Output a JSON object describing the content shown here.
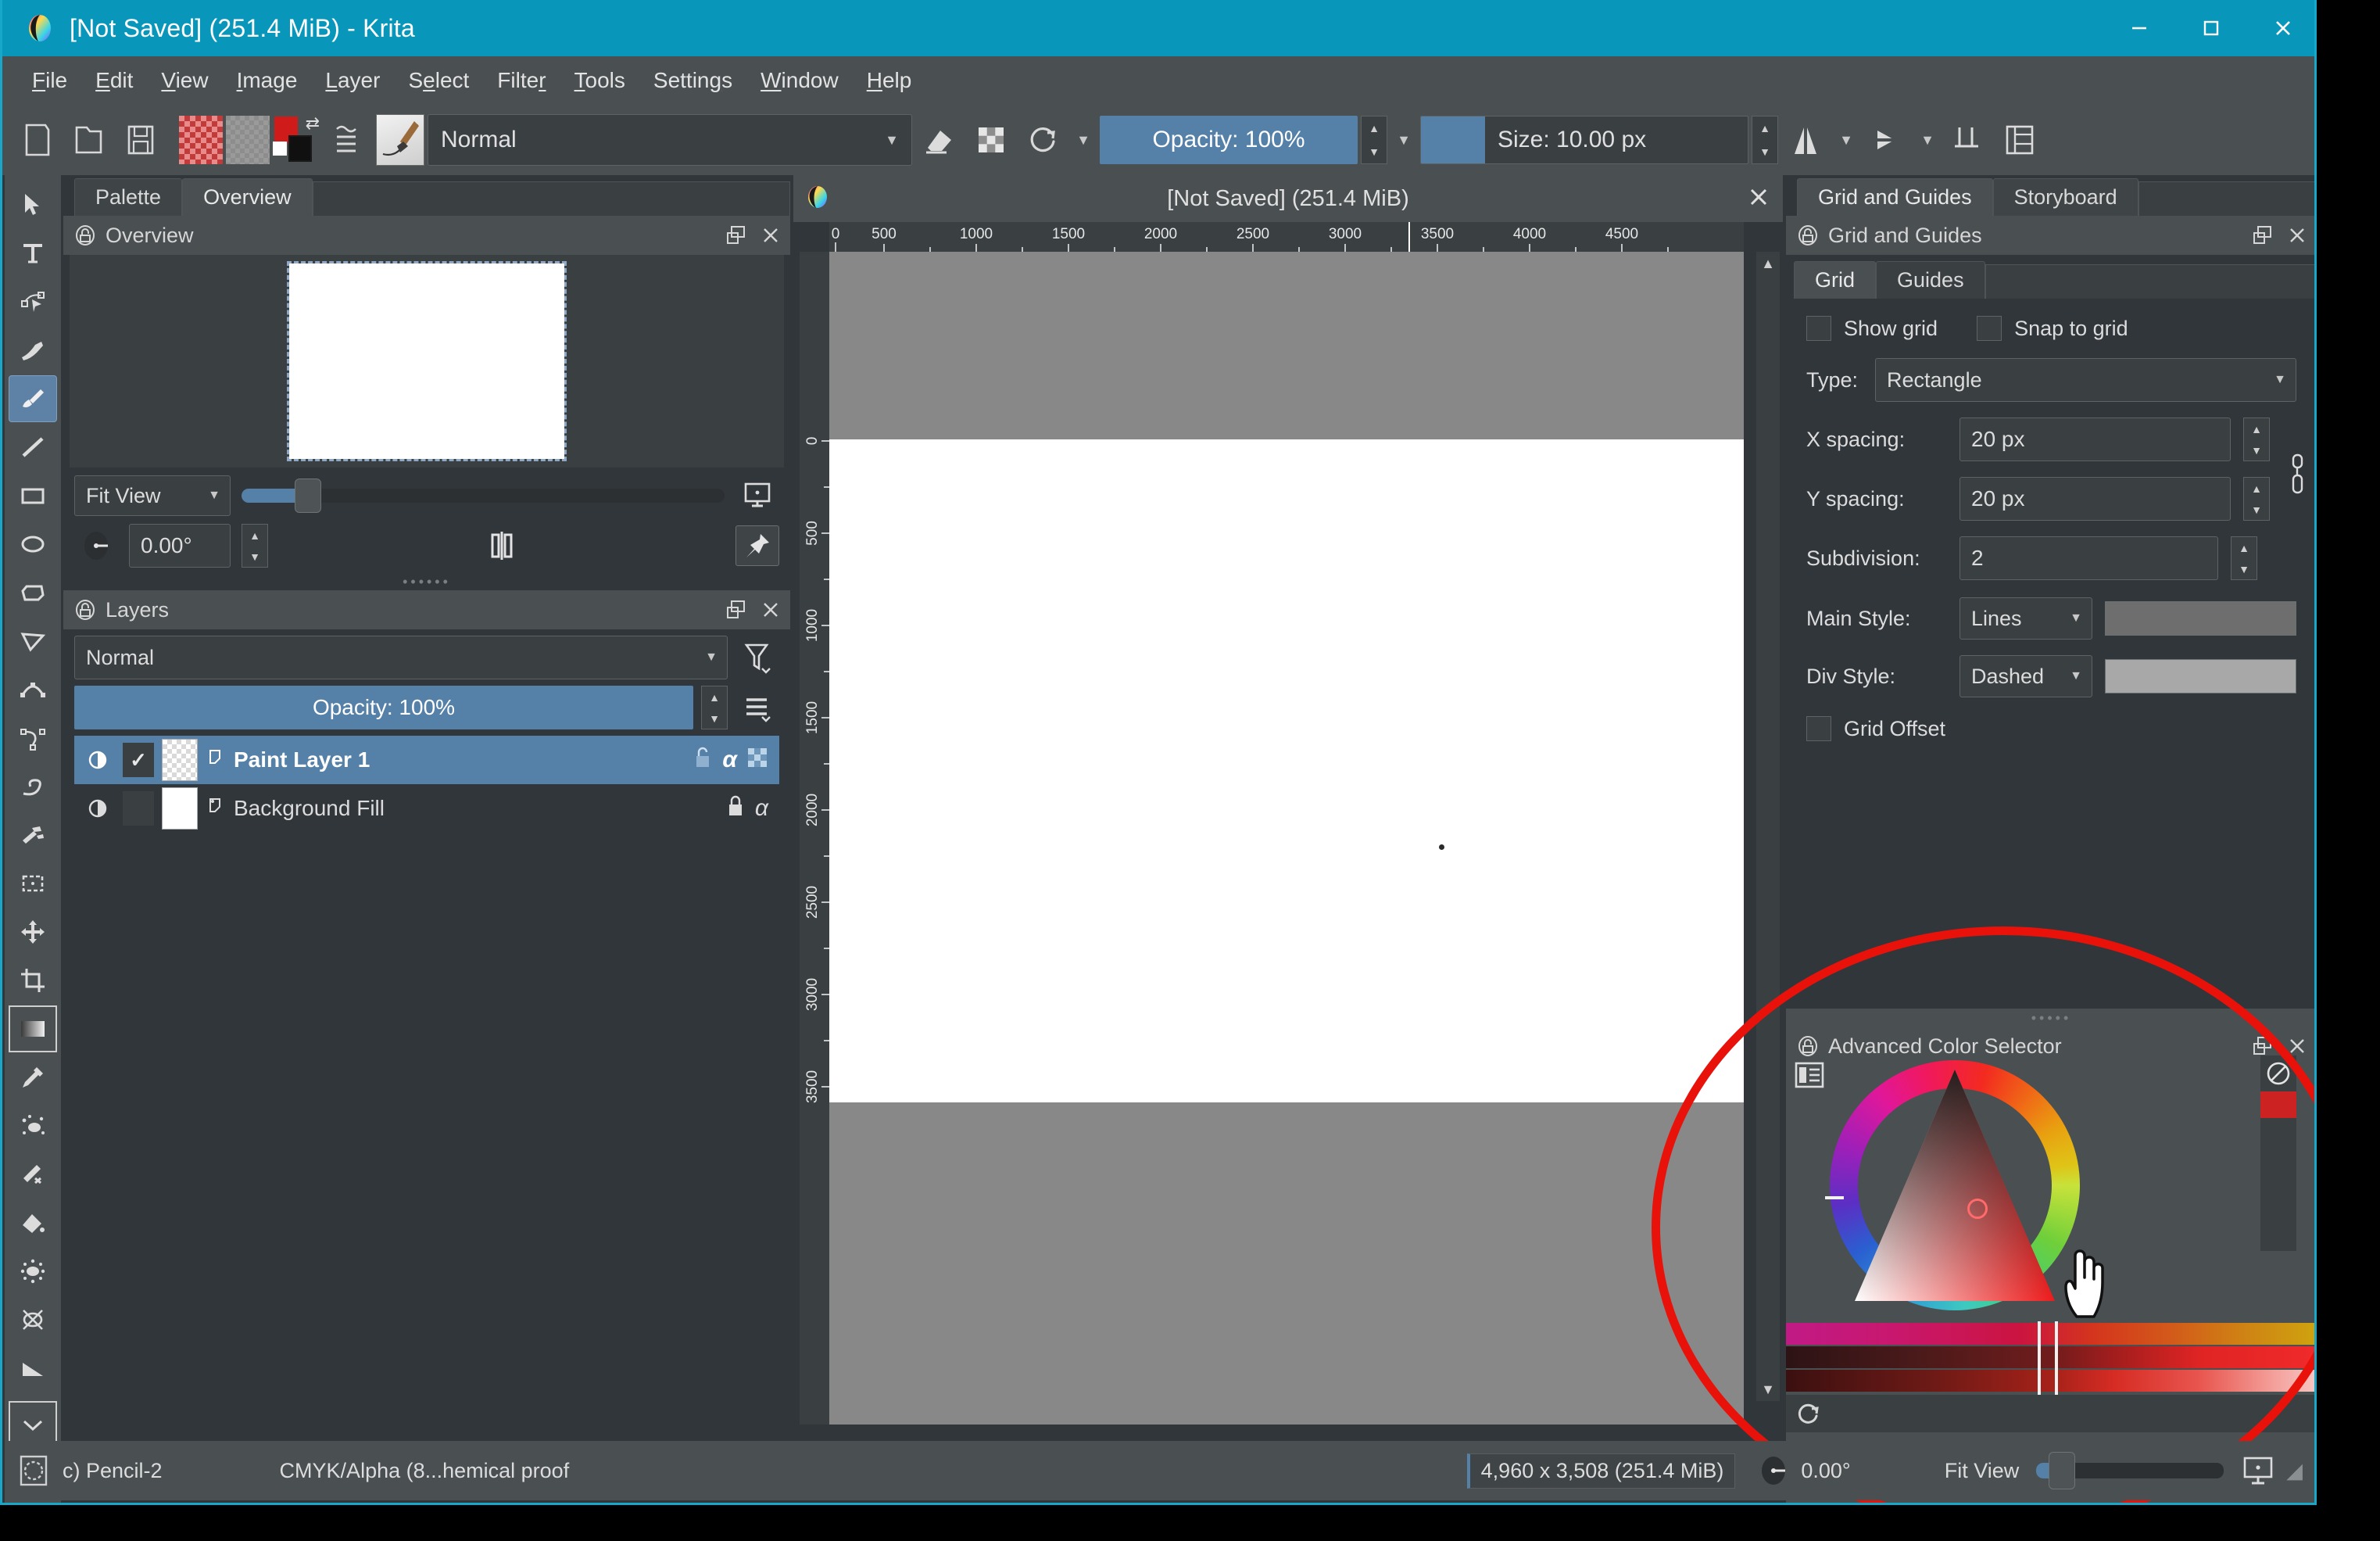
{
  "window": {
    "title": "[Not Saved]  (251.4 MiB)  - Krita",
    "minimize_label": "minimize-button",
    "maximize_label": "maximize-button",
    "close_label": "close-button"
  },
  "menubar": {
    "items": [
      "File",
      "Edit",
      "View",
      "Image",
      "Layer",
      "Select",
      "Filter",
      "Tools",
      "Settings",
      "Window",
      "Help"
    ]
  },
  "toolbar": {
    "blend_mode": "Normal",
    "opacity": "Opacity: 100%",
    "size": "Size: 10.00 px"
  },
  "left_dock": {
    "tabs": [
      {
        "label": "Palette",
        "active": false
      },
      {
        "label": "Overview",
        "active": true
      }
    ],
    "overview": {
      "title": "Overview",
      "zoom_mode": "Fit View",
      "rotation": "0.00°"
    },
    "layers": {
      "title": "Layers",
      "blend_mode": "Normal",
      "opacity": "Opacity:  100%",
      "items": [
        {
          "name": "Paint Layer 1",
          "selected": true,
          "visible": true,
          "checked": true,
          "alpha": "α"
        },
        {
          "name": "Background Fill",
          "selected": false,
          "visible": true,
          "checked": false,
          "alpha": "α"
        }
      ]
    }
  },
  "canvas": {
    "document_tab": "[Not Saved]  (251.4 MiB)",
    "ruler_h_ticks": [
      "0",
      "500",
      "1000",
      "1500",
      "2000",
      "2500",
      "3000",
      "3500",
      "4000",
      "4500"
    ],
    "ruler_v_ticks": [
      "0",
      "500",
      "1000",
      "1500",
      "2000",
      "2500",
      "3000",
      "3500"
    ]
  },
  "right_dock": {
    "tabs": [
      {
        "label": "Grid and Guides",
        "active": true
      },
      {
        "label": "Storyboard",
        "active": false
      }
    ],
    "grid_and_guides": {
      "title": "Grid and Guides",
      "subtabs": [
        {
          "label": "Grid",
          "active": true
        },
        {
          "label": "Guides",
          "active": false
        }
      ],
      "show_grid_label": "Show grid",
      "snap_to_grid_label": "Snap to grid",
      "type_label": "Type:",
      "type_value": "Rectangle",
      "x_spacing_label": "X spacing:",
      "x_spacing_value": "20 px",
      "y_spacing_label": "Y spacing:",
      "y_spacing_value": "20 px",
      "subdivision_label": "Subdivision:",
      "subdivision_value": "2",
      "main_style_label": "Main Style:",
      "main_style_value": "Lines",
      "main_style_color": "#6e6e6e",
      "div_style_label": "Div Style:",
      "div_style_value": "Dashed",
      "div_style_color": "#a8a8a8",
      "grid_offset_label": "Grid Offset"
    },
    "advanced_color_selector": {
      "title": "Advanced Color Selector",
      "current_color": "#cc2222"
    }
  },
  "statusbar": {
    "brush_preset": "c) Pencil-2",
    "color_profile": "CMYK/Alpha (8...hemical proof",
    "dimensions": "4,960 x 3,508 (251.4 MiB)",
    "rotation": "0.00°",
    "zoom_mode": "Fit View"
  },
  "colors": {
    "titlebar": "#0897ba",
    "chrome": "#4a4f52",
    "panel": "#31363b",
    "accent": "#5580a8",
    "annotation": "#e8120b"
  }
}
